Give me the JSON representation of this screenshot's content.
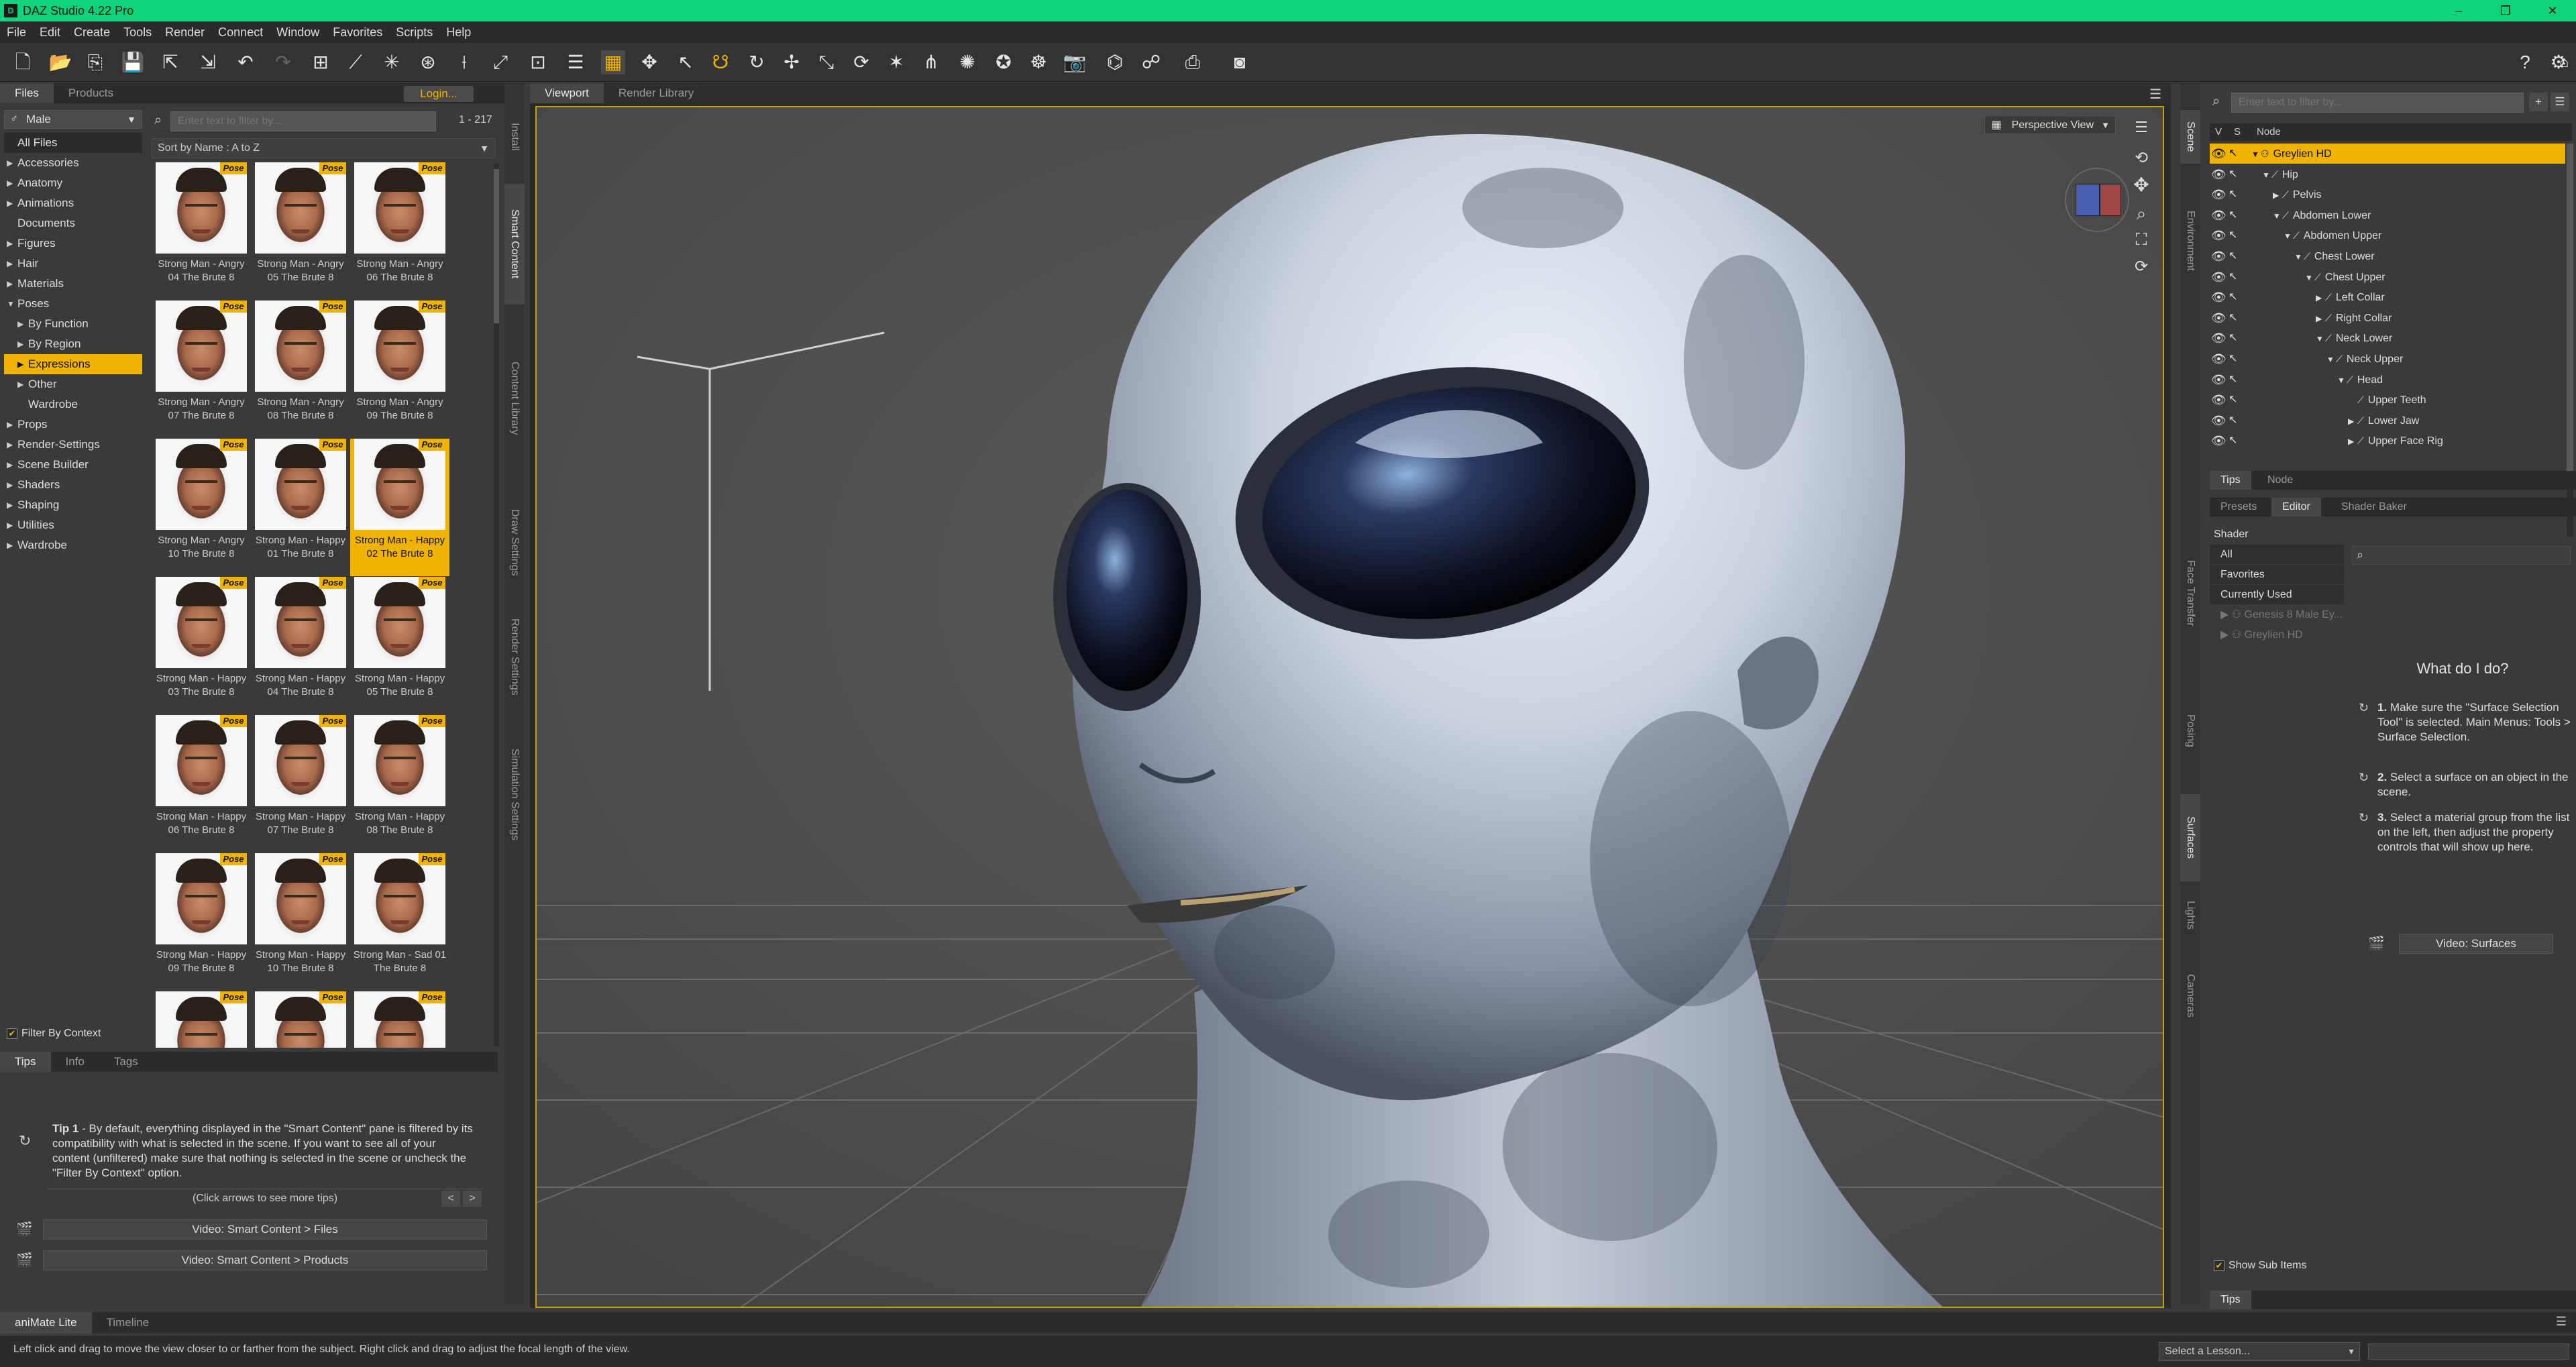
{
  "window": {
    "title": "DAZ Studio 4.22 Pro"
  },
  "menu": [
    "File",
    "Edit",
    "Create",
    "Tools",
    "Render",
    "Connect",
    "Window",
    "Favorites",
    "Scripts",
    "Help"
  ],
  "left_panel": {
    "tabs": [
      "Files",
      "Products"
    ],
    "login_label": "Login...",
    "figure_select": "Male",
    "search_placeholder": "Enter text to filter by...",
    "result_count": "1 - 217",
    "sort_label": "Sort by Name : A to Z",
    "categories": [
      {
        "label": "All Files",
        "arrow": "",
        "indent": 0
      },
      {
        "label": "Accessories",
        "arrow": "▶",
        "indent": 0
      },
      {
        "label": "Anatomy",
        "arrow": "▶",
        "indent": 0
      },
      {
        "label": "Animations",
        "arrow": "▶",
        "indent": 0
      },
      {
        "label": "Documents",
        "arrow": "",
        "indent": 0
      },
      {
        "label": "Figures",
        "arrow": "▶",
        "indent": 0
      },
      {
        "label": "Hair",
        "arrow": "▶",
        "indent": 0
      },
      {
        "label": "Materials",
        "arrow": "▶",
        "indent": 0
      },
      {
        "label": "Poses",
        "arrow": "▼",
        "indent": 0
      },
      {
        "label": "By Function",
        "arrow": "▶",
        "indent": 1
      },
      {
        "label": "By Region",
        "arrow": "▶",
        "indent": 1
      },
      {
        "label": "Expressions",
        "arrow": "▶",
        "indent": 1
      },
      {
        "label": "Other",
        "arrow": "▶",
        "indent": 1
      },
      {
        "label": "Wardrobe",
        "arrow": "",
        "indent": 1
      },
      {
        "label": "Props",
        "arrow": "▶",
        "indent": 0
      },
      {
        "label": "Render-Settings",
        "arrow": "▶",
        "indent": 0
      },
      {
        "label": "Scene Builder",
        "arrow": "▶",
        "indent": 0
      },
      {
        "label": "Shaders",
        "arrow": "▶",
        "indent": 0
      },
      {
        "label": "Shaping",
        "arrow": "▶",
        "indent": 0
      },
      {
        "label": "Utilities",
        "arrow": "▶",
        "indent": 0
      },
      {
        "label": "Wardrobe",
        "arrow": "▶",
        "indent": 0
      }
    ],
    "selected_category": "Expressions",
    "badge": "Pose",
    "thumbnails": [
      "Strong Man - Angry 04 The Brute 8",
      "Strong Man - Angry 05 The Brute 8",
      "Strong Man - Angry 06 The Brute 8",
      "Strong Man - Angry 07 The Brute 8",
      "Strong Man - Angry 08 The Brute 8",
      "Strong Man - Angry 09 The Brute 8",
      "Strong Man - Angry 10 The Brute 8",
      "Strong Man - Happy 01 The Brute 8",
      "Strong Man - Happy 02 The Brute 8",
      "Strong Man - Happy 03 The Brute 8",
      "Strong Man - Happy 04 The Brute 8",
      "Strong Man - Happy 05 The Brute 8",
      "Strong Man - Happy 06 The Brute 8",
      "Strong Man - Happy 07 The Brute 8",
      "Strong Man - Happy 08 The Brute 8",
      "Strong Man - Happy 09 The Brute 8",
      "Strong Man - Happy 10 The Brute 8",
      "Strong Man - Sad 01 The Brute 8",
      "",
      "",
      ""
    ],
    "selected_thumbnail": "Strong Man - Happy 02 The Brute 8",
    "filter_by_context": "Filter By Context",
    "vertical_tabs": [
      "Install",
      "Smart Content",
      "Content Library",
      "Draw Settings",
      "Render Settings",
      "Simulation Settings"
    ]
  },
  "tips_pane": {
    "tabs": [
      "Tips",
      "Info",
      "Tags"
    ],
    "tip_title": "Tip 1",
    "tip_text": " - By default, everything displayed in the \"Smart Content\" pane is filtered by its compatibility with what is selected in the scene. If you want to see all of your content (unfiltered) make sure that nothing is selected in the scene or uncheck the \"Filter By Context\" option.",
    "nav_hint": "(Click arrows to see more tips)",
    "video_files": "Video: Smart Content > Files",
    "video_products": "Video: Smart Content > Products"
  },
  "viewport": {
    "tabs": [
      "Viewport",
      "Render Library"
    ],
    "camera": "Perspective View"
  },
  "scene": {
    "filter_placeholder": "Enter text to filter by...",
    "columns": [
      "V",
      "S",
      "Node"
    ],
    "nodes": [
      {
        "label": "Greylien HD",
        "depth": 0,
        "twist": "▼",
        "selected": true,
        "bone": "figure"
      },
      {
        "label": "Hip",
        "depth": 1,
        "twist": "▼"
      },
      {
        "label": "Pelvis",
        "depth": 2,
        "twist": "▶"
      },
      {
        "label": "Abdomen Lower",
        "depth": 2,
        "twist": "▼"
      },
      {
        "label": "Abdomen Upper",
        "depth": 3,
        "twist": "▼"
      },
      {
        "label": "Chest Lower",
        "depth": 4,
        "twist": "▼"
      },
      {
        "label": "Chest Upper",
        "depth": 5,
        "twist": "▼"
      },
      {
        "label": "Left Collar",
        "depth": 6,
        "twist": "▶"
      },
      {
        "label": "Right Collar",
        "depth": 6,
        "twist": "▶"
      },
      {
        "label": "Neck Lower",
        "depth": 6,
        "twist": "▼"
      },
      {
        "label": "Neck Upper",
        "depth": 7,
        "twist": "▼"
      },
      {
        "label": "Head",
        "depth": 8,
        "twist": "▼"
      },
      {
        "label": "Upper Teeth",
        "depth": 9,
        "twist": ""
      },
      {
        "label": "Lower Jaw",
        "depth": 9,
        "twist": "▶"
      },
      {
        "label": "Upper Face Rig",
        "depth": 9,
        "twist": "▶"
      }
    ],
    "right_vtabs": [
      "Scene",
      "Environment"
    ]
  },
  "node_tabs": [
    "Tips",
    "Node"
  ],
  "surfaces": {
    "tabs": [
      "Presets",
      "Editor",
      "Shader Baker"
    ],
    "shader_label": "Shader",
    "items": [
      "All",
      "Favorites",
      "Currently Used"
    ],
    "objects": [
      "Genesis 8 Male Ey...",
      "Greylien HD"
    ],
    "what_title": "What do I do?",
    "steps": [
      {
        "num": "1.",
        "text": "Make sure the \"Surface Selection Tool\" is selected. Main Menus: Tools > Surface Selection."
      },
      {
        "num": "2.",
        "text": "Select a surface on an object in the scene."
      },
      {
        "num": "3.",
        "text": "Select a material group from the list on the left, then adjust the property controls that will show up here."
      }
    ],
    "video": "Video: Surfaces",
    "show_sub": "Show Sub Items",
    "bottom_tab": "Tips",
    "right_vtabs": [
      "Face Transfer",
      "Posing",
      "Surfaces",
      "Lights",
      "Cameras"
    ]
  },
  "bottom": {
    "tabs": [
      "aniMate Lite",
      "Timeline"
    ],
    "status": "Left click and drag to move the view closer to or farther from the subject. Right click and drag to adjust the focal length of the view.",
    "lesson": "Select a Lesson..."
  },
  "colors": {
    "accent": "#f0b400",
    "titlebar": "#0ed37a"
  }
}
